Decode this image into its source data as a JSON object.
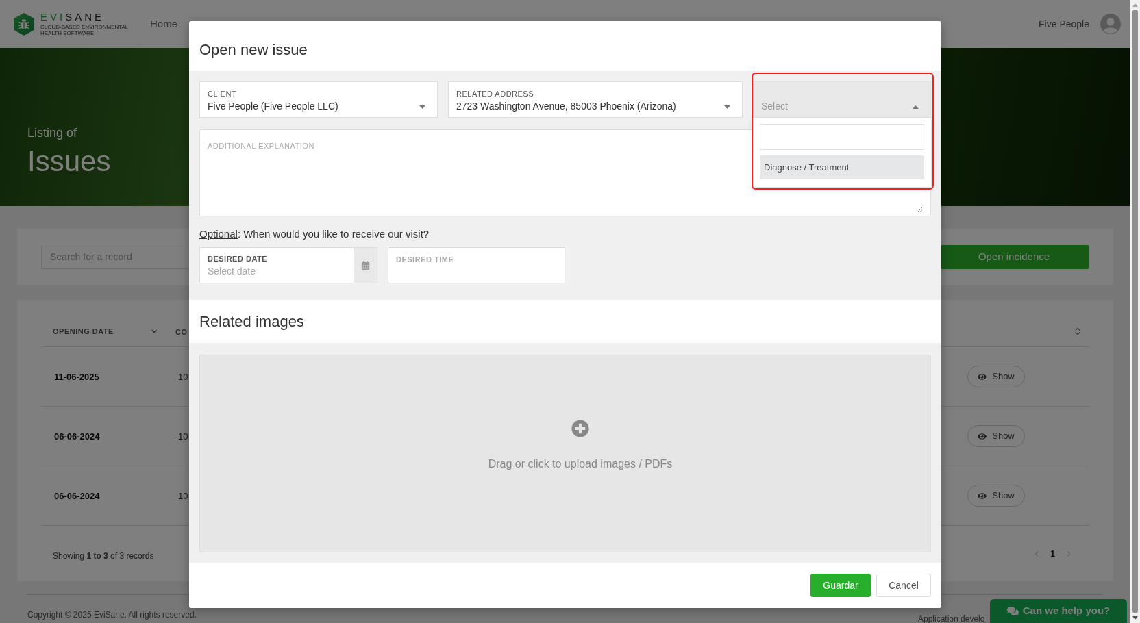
{
  "navbar": {
    "logo_text": "EVISANE",
    "tagline": "CLOUD-BASED ENVIRONMENTAL HEALTH SOFTWARE",
    "links": [
      {
        "label": "Home"
      }
    ],
    "user_name": "Five People"
  },
  "hero": {
    "subtitle": "Listing of",
    "title": "Issues"
  },
  "toolbar": {
    "search_placeholder": "Search for a record",
    "action_button": "Open incidence"
  },
  "table": {
    "columns": [
      {
        "label": "OPENING DATE"
      },
      {
        "label": "CO"
      }
    ],
    "rows": [
      {
        "opening_date": "11-06-2025",
        "column_2": "10",
        "action": "Show"
      },
      {
        "opening_date": "06-06-2024",
        "column_2": "10",
        "action": "Show"
      },
      {
        "opening_date": "06-06-2024",
        "column_2": "10",
        "action": "Show"
      }
    ],
    "summary": "Showing **1 to 3** of 3 records",
    "pages": [
      {
        "label": "1",
        "selected": true
      }
    ]
  },
  "footer": {
    "copyright": "Copyright © 2025 EviSane. All rights reserved.",
    "credit": "Application develo"
  },
  "chat_button": {
    "label": "Can we help you?"
  },
  "modal": {
    "title": "Open new issue",
    "selects": [
      {
        "label": "CLIENT",
        "value": "Five People (Five People LLC)",
        "expanded": false,
        "highlighted": false
      },
      {
        "label": "RELATED ADDRESS",
        "value": "2723 Washington Avenue, 85003 Phoenix (Arizona)",
        "expanded": false,
        "highlighted": false
      },
      {
        "placeholder": "Select",
        "expanded": true,
        "highlighted": true,
        "options": [
          {
            "label": "Diagnose / Treatment",
            "selected": true
          }
        ]
      }
    ],
    "explanation": {
      "label": "ADDITIONAL EXPLANATION"
    },
    "visit_prompt": {
      "link": "Optional",
      "text": ": When would you like to receive our visit?"
    },
    "date_field": {
      "label": "DESIRED DATE",
      "placeholder": "Select date"
    },
    "time_field": {
      "label": "DESIRED TIME"
    },
    "images": {
      "title": "Related images",
      "dropzone_text": "Drag or click to upload images / PDFs"
    },
    "buttons": [
      {
        "kind": "primary",
        "label": "Guardar"
      },
      {
        "kind": "secondary",
        "label": "Cancel"
      }
    ]
  }
}
